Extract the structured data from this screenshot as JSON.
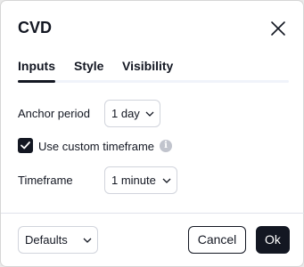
{
  "dialog": {
    "title": "CVD",
    "close_icon": "close-icon"
  },
  "tabs": [
    {
      "label": "Inputs",
      "active": true
    },
    {
      "label": "Style",
      "active": false
    },
    {
      "label": "Visibility",
      "active": false
    }
  ],
  "inputs": {
    "anchor_period_label": "Anchor period",
    "anchor_period_value": "1 day",
    "use_custom_timeframe_label": "Use custom timeframe",
    "use_custom_timeframe_checked": true,
    "info_icon": "info-icon",
    "timeframe_label": "Timeframe",
    "timeframe_value": "1 minute"
  },
  "footer": {
    "defaults_label": "Defaults",
    "cancel_label": "Cancel",
    "ok_label": "Ok"
  },
  "colors": {
    "accent": "#131722",
    "border": "#d1d4dc",
    "info_icon_bg": "#c1c4cd"
  }
}
